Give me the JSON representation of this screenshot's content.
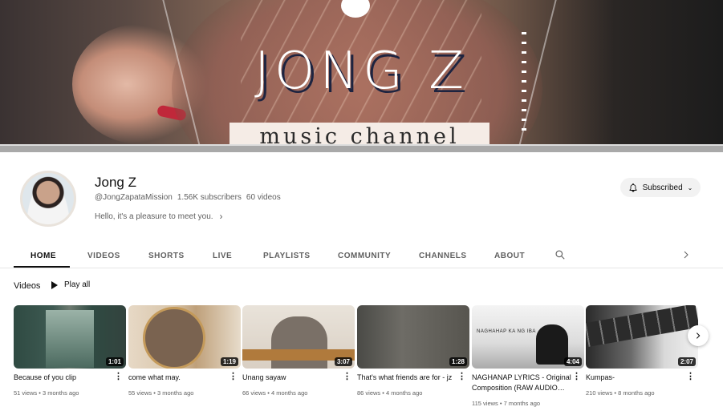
{
  "banner": {
    "title": "JONG Z",
    "subtitle": "music channel"
  },
  "channel": {
    "name": "Jong Z",
    "handle": "@JongZapataMission",
    "subscribers": "1.56K subscribers",
    "videos_count": "60 videos",
    "description": "Hello, it's a pleasure to meet you."
  },
  "subscribe_button": {
    "label": "Subscribed",
    "icon": "bell-icon"
  },
  "tabs": [
    {
      "label": "HOME",
      "active": true
    },
    {
      "label": "VIDEOS",
      "active": false
    },
    {
      "label": "SHORTS",
      "active": false
    },
    {
      "label": "LIVE",
      "active": false
    },
    {
      "label": "PLAYLISTS",
      "active": false
    },
    {
      "label": "COMMUNITY",
      "active": false
    },
    {
      "label": "CHANNELS",
      "active": false
    },
    {
      "label": "ABOUT",
      "active": false
    }
  ],
  "section": {
    "title": "Videos",
    "play_all": "Play all"
  },
  "videos": [
    {
      "title": "Because of you clip",
      "duration": "1:01",
      "meta": "51 views • 3 months ago"
    },
    {
      "title": "come what may.",
      "duration": "1:19",
      "meta": "55 views • 3 months ago"
    },
    {
      "title": "Unang sayaw",
      "duration": "3:07",
      "meta": "66 views • 4 months ago"
    },
    {
      "title": "That's what friends are for - jz",
      "duration": "1:28",
      "meta": "86 views • 4 months ago"
    },
    {
      "title": "NAGHANAP LYRICS - Original Composition (RAW AUDIO…",
      "duration": "4:04",
      "meta": "115 views • 7 months ago",
      "thumb_text": "NAGHAHAP KA NG IBA"
    },
    {
      "title": "Kumpas-",
      "duration": "2:07",
      "meta": "210 views • 8 months ago"
    }
  ]
}
